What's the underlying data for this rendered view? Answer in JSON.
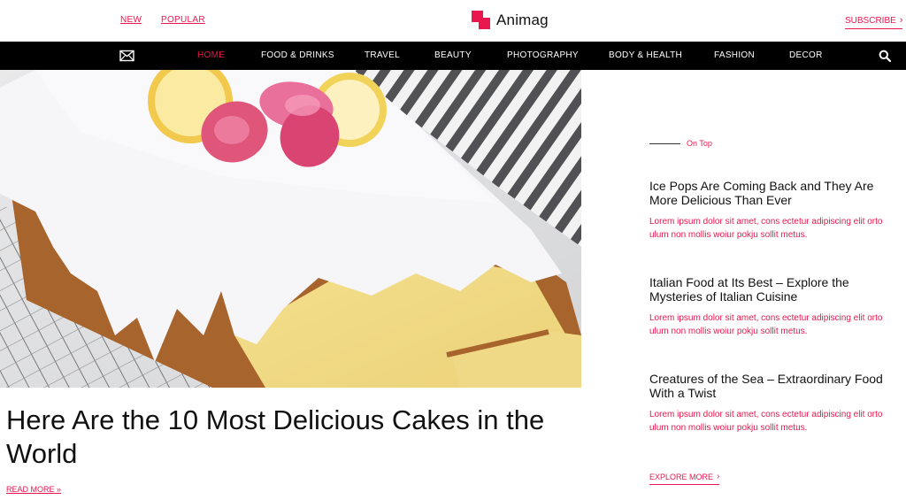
{
  "topbar": {
    "links": [
      "NEW",
      "POPULAR"
    ],
    "brand": "Animag",
    "subscribe": "SUBSCRIBE",
    "accent": "#e8174d"
  },
  "nav": {
    "items": [
      "HOME",
      "FOOD & DRINKS",
      "TRAVEL",
      "BEAUTY",
      "PHOTOGRAPHY",
      "BODY & HEALTH",
      "FASHION",
      "DECOR"
    ],
    "active": "HOME",
    "icons": [
      "mail-icon",
      "search-icon"
    ]
  },
  "feature": {
    "headline": "Here Are the 10 Most Delicious Cakes in the World",
    "read_more": "READ MORE »"
  },
  "sidebar": {
    "section_label": "On Top",
    "posts": [
      {
        "title": "Ice Pops Are Coming Back and They Are More Delicious Than Ever",
        "excerpt": "Lorem ipsum dolor sit amet, cons ectetur adipiscing elit orto ulum non mollis woiur pokju sollit metus."
      },
      {
        "title": "Italian Food at Its Best – Explore the Mysteries of Italian Cuisine",
        "excerpt": "Lorem ipsum dolor sit amet, cons ectetur adipiscing elit orto ulum non mollis woiur pokju sollit metus."
      },
      {
        "title": "Creatures of the Sea – Extraordinary Food With a Twist",
        "excerpt": "Lorem ipsum dolor sit amet, cons ectetur adipiscing elit orto ulum non mollis woiur pokju sollit metus."
      }
    ],
    "explore_more": "EXPLORE MORE"
  }
}
